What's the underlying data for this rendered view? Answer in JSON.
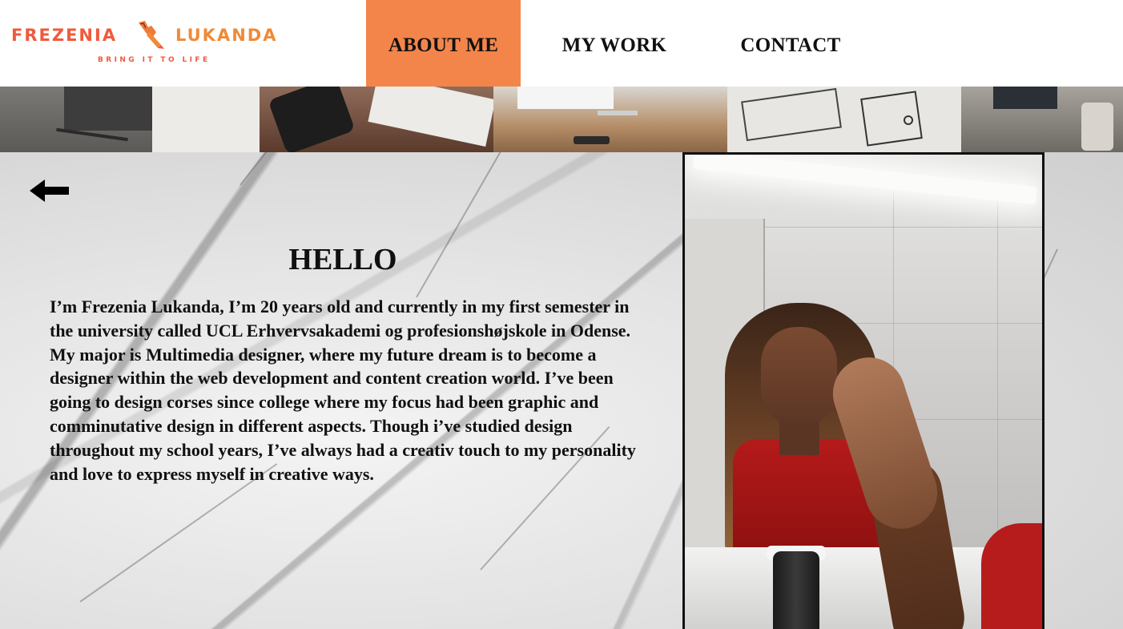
{
  "logo": {
    "left": "FREZENIA",
    "right": "LUKANDA",
    "tagline": "BRING IT TO LIFE",
    "mark_icon": "pencil-hand-icon",
    "colors": {
      "red": "#ef5a3c",
      "orange": "#f08a37"
    }
  },
  "nav": {
    "items": [
      {
        "label": "ABOUT ME",
        "active": true
      },
      {
        "label": "MY WORK",
        "active": false
      },
      {
        "label": "CONTACT",
        "active": false
      }
    ],
    "active_color": "#f4854a"
  },
  "main": {
    "back_icon": "left-arrow-icon",
    "heading": "HELLO",
    "bio": "I’m Frezenia Lukanda, I’m 20 years old and currently in my first semester in the university called UCL Erhvervsakademi og profesionshøjskole in Odense. My major is Multimedia designer, where my future dream is to become a designer within the web development and content creation world. I’ve been going to design corses since college where my focus had been graphic and comminutative design in different aspects. Though i’ve studied design throughout my school years, I’ve always had a creativ touch to my personality and love to express myself in creative ways."
  }
}
